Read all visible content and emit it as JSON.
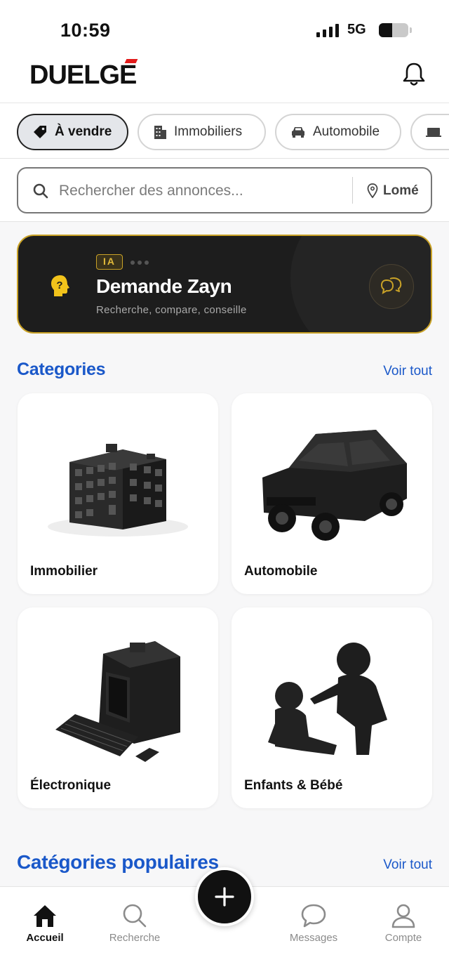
{
  "status_bar": {
    "time": "10:59",
    "network": "5G",
    "battery_level": 0.45
  },
  "header": {
    "logo_text": "DUELGE"
  },
  "chips": [
    {
      "label": "À vendre",
      "icon": "tag-icon",
      "active": true
    },
    {
      "label": "Immobiliers",
      "icon": "building-icon",
      "active": false
    },
    {
      "label": "Automobile",
      "icon": "car-icon",
      "active": false
    },
    {
      "label": "",
      "icon": "laptop-icon",
      "active": false
    }
  ],
  "search": {
    "placeholder": "Rechercher des annonces...",
    "location": "Lomé"
  },
  "ai_banner": {
    "badge": "IA",
    "title": "Demande Zayn",
    "subtitle": "Recherche, compare, conseille",
    "accent_color": "#c9a227"
  },
  "categories": {
    "title": "Categories",
    "link": "Voir tout",
    "items": [
      {
        "label": "Immobilier",
        "icon": "apartment-building-image"
      },
      {
        "label": "Automobile",
        "icon": "suv-car-image"
      },
      {
        "label": "Électronique",
        "icon": "retro-computer-image"
      },
      {
        "label": "Enfants & Bébé",
        "icon": "children-image"
      }
    ]
  },
  "popular": {
    "title": "Catégories populaires",
    "link": "Voir tout"
  },
  "bottom_nav": {
    "items": [
      {
        "label": "Accueil",
        "icon": "home-icon",
        "active": true
      },
      {
        "label": "Recherche",
        "icon": "search-icon",
        "active": false
      },
      {
        "label": "Messages",
        "icon": "chat-icon",
        "active": false
      },
      {
        "label": "Compte",
        "icon": "user-icon",
        "active": false
      }
    ],
    "fab_icon": "plus-icon"
  },
  "colors": {
    "brand_blue": "#1a58c9",
    "logo_red": "#e21b1b",
    "gold": "#c9a227"
  }
}
